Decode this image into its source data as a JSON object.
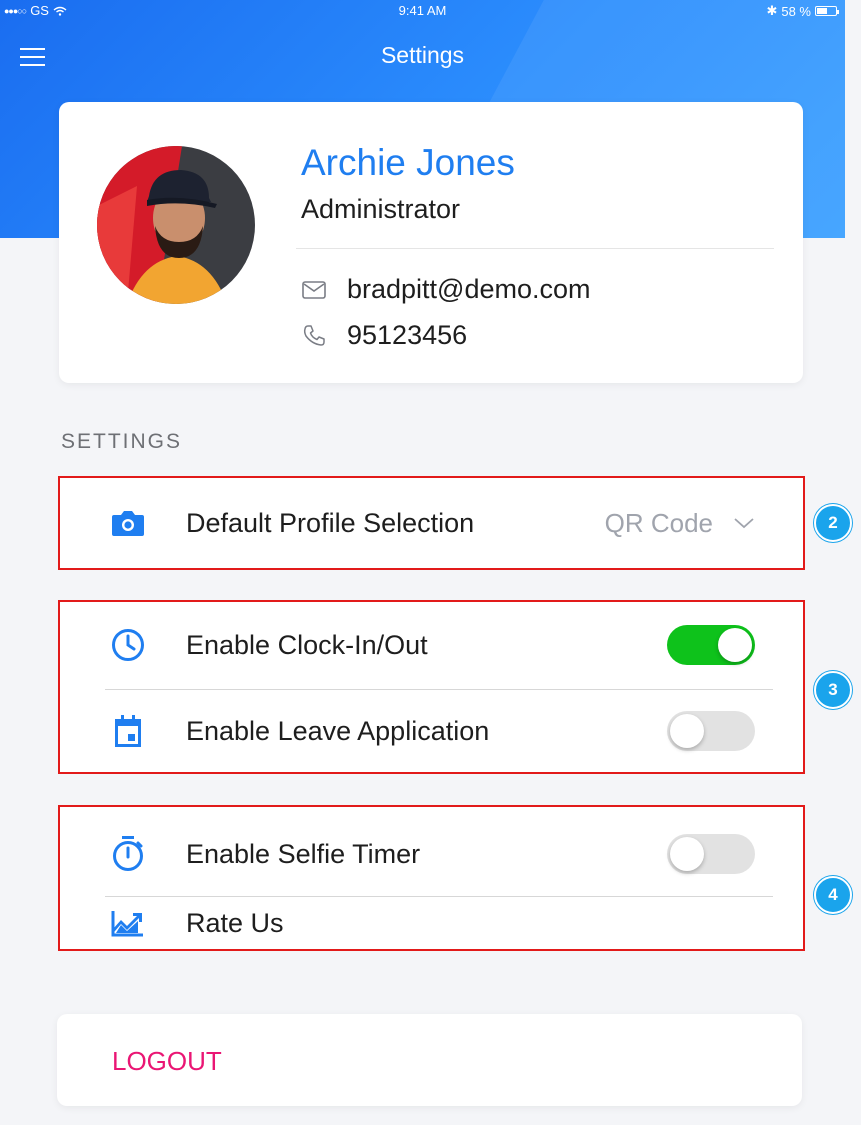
{
  "status_bar": {
    "carrier": "GS",
    "time": "9:41 AM",
    "battery": "58 %",
    "battery_level": 0.58
  },
  "nav": {
    "title": "Settings",
    "menu_icon": "hamburger-menu-icon"
  },
  "profile": {
    "name": "Archie Jones",
    "role": "Administrator",
    "email": "bradpitt@demo.com",
    "phone": "95123456",
    "email_icon": "mail-icon",
    "phone_icon": "phone-icon"
  },
  "settings": {
    "section_label": "SETTINGS",
    "default_profile": {
      "label": "Default Profile Selection",
      "value": "QR Code",
      "icon": "camera-icon"
    },
    "clock_in_out": {
      "label": "Enable Clock-In/Out",
      "enabled": true,
      "icon": "clock-icon"
    },
    "leave_application": {
      "label": "Enable Leave Application",
      "enabled": false,
      "icon": "calendar-icon"
    },
    "selfie_timer": {
      "label": "Enable Selfie Timer",
      "enabled": false,
      "icon": "stopwatch-icon"
    },
    "rate_us": {
      "label": "Rate Us",
      "icon": "trending-chart-icon"
    }
  },
  "annotations": {
    "badge_2": "2",
    "badge_3": "3",
    "badge_4": "4"
  },
  "logout": {
    "label": "LOGOUT"
  },
  "colors": {
    "accent": "#1f7ef0",
    "toggle_on": "#0ec21b",
    "logout": "#ea1674",
    "annotation_border": "#e21a1a",
    "badge": "#1aa4ec"
  }
}
